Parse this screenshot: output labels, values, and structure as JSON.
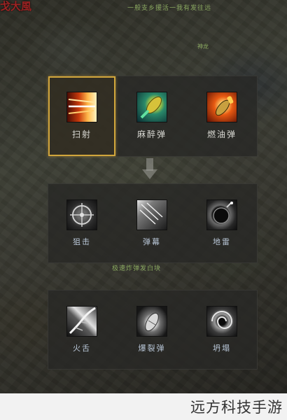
{
  "hud": {
    "title": "戈大風",
    "message": "一般支乡援活一我有发往远",
    "tag": "神龙",
    "hint": "极速炸弹发白块"
  },
  "skill_tree": {
    "tiers": [
      {
        "skills": [
          {
            "label": "扫射",
            "icon": "sweep-fire-icon",
            "selected": true
          },
          {
            "label": "麻醉弹",
            "icon": "tranquilizer-round-icon",
            "selected": false
          },
          {
            "label": "燃油弹",
            "icon": "incendiary-round-icon",
            "selected": false
          }
        ]
      },
      {
        "skills": [
          {
            "label": "狙击",
            "icon": "crosshair-icon",
            "selected": false
          },
          {
            "label": "弹幕",
            "icon": "barrage-icon",
            "selected": false
          },
          {
            "label": "地雷",
            "icon": "mine-icon",
            "selected": false
          }
        ]
      },
      {
        "skills": [
          {
            "label": "火舌",
            "icon": "fire-tongue-icon",
            "selected": false
          },
          {
            "label": "爆裂弹",
            "icon": "explosive-round-icon",
            "selected": false
          },
          {
            "label": "坍塌",
            "icon": "collapse-vortex-icon",
            "selected": false
          }
        ]
      }
    ]
  },
  "watermark": "远方科技手游",
  "colors": {
    "selected_border": "#d1a63c",
    "panel_bg": "#282826",
    "hud_text": "#8aa860",
    "title_red": "#9b2323"
  }
}
